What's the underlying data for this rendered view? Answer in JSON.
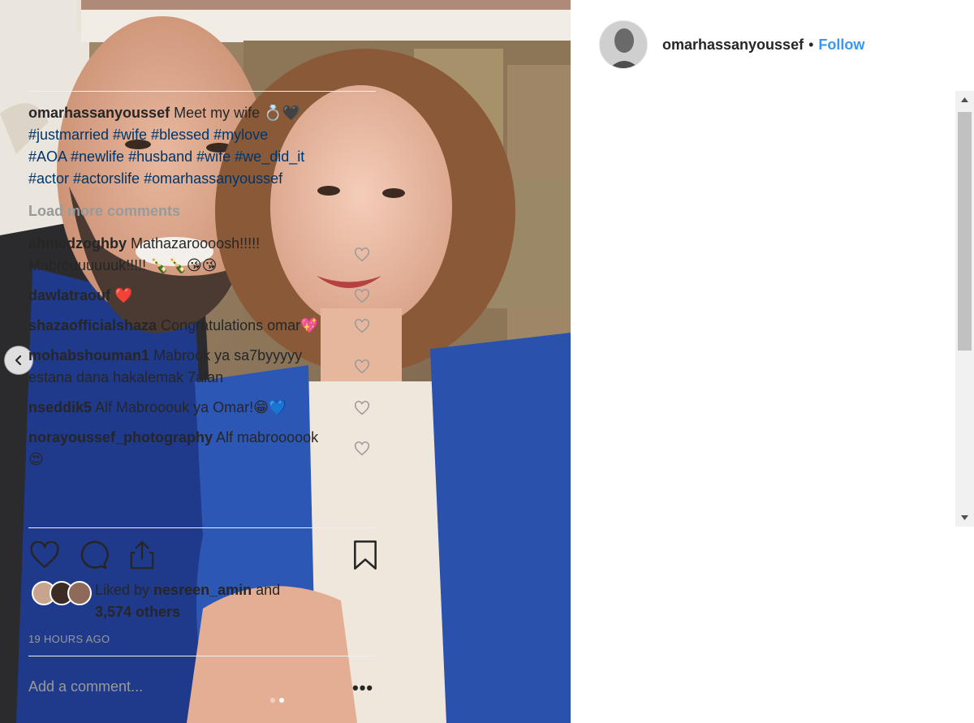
{
  "post": {
    "username": "omarhassanyoussef",
    "separator": "•",
    "follow_label": "Follow",
    "caption": {
      "username": "omarhassanyoussef",
      "text": "Meet my wife 💍🖤",
      "hashtags_line1": "#justmarried #wife #blessed #mylove",
      "hashtags_line2": "#AOA #newlife #husband #wife #we_did_it",
      "hashtags_line3": "#actor #actorslife #omarhassanyoussef"
    },
    "load_more_label": "Load more comments",
    "comments": [
      {
        "username": "ahmedzoghby",
        "text": "Mathazaroooosh!!!!! Mabrouuuuuuk!!!!! 🍾🍾😘😘"
      },
      {
        "username": "dawlatraouf",
        "text": "❤️"
      },
      {
        "username": "shazaofficialshaza",
        "text": "Congratulations omar💖"
      },
      {
        "username": "mohabshouman1",
        "text": "Mabrook ya sa7byyyyy estana dana hakalemak 7alan"
      },
      {
        "username": "nseddik5",
        "text": "Alf Mabrooouk ya Omar!😁💙"
      },
      {
        "username": "norayoussef_photography",
        "text": "Alf mabroooook 😍"
      }
    ],
    "likes": {
      "prefix": "Liked by ",
      "user": "nesreen_amin",
      "middle": " and",
      "others": "3,574 others"
    },
    "timestamp": "19 HOURS AGO",
    "add_comment_placeholder": "Add a comment...",
    "more_options": "•••",
    "carousel": {
      "slides": 2,
      "active": 2
    },
    "colors": {
      "link": "#3897f0",
      "hashtag": "#003569",
      "muted": "#999999",
      "like": "#ed4956"
    },
    "icons": [
      "chevron-left-icon",
      "heart-icon",
      "comment-icon",
      "share-icon",
      "bookmark-icon",
      "more-options-icon"
    ]
  }
}
